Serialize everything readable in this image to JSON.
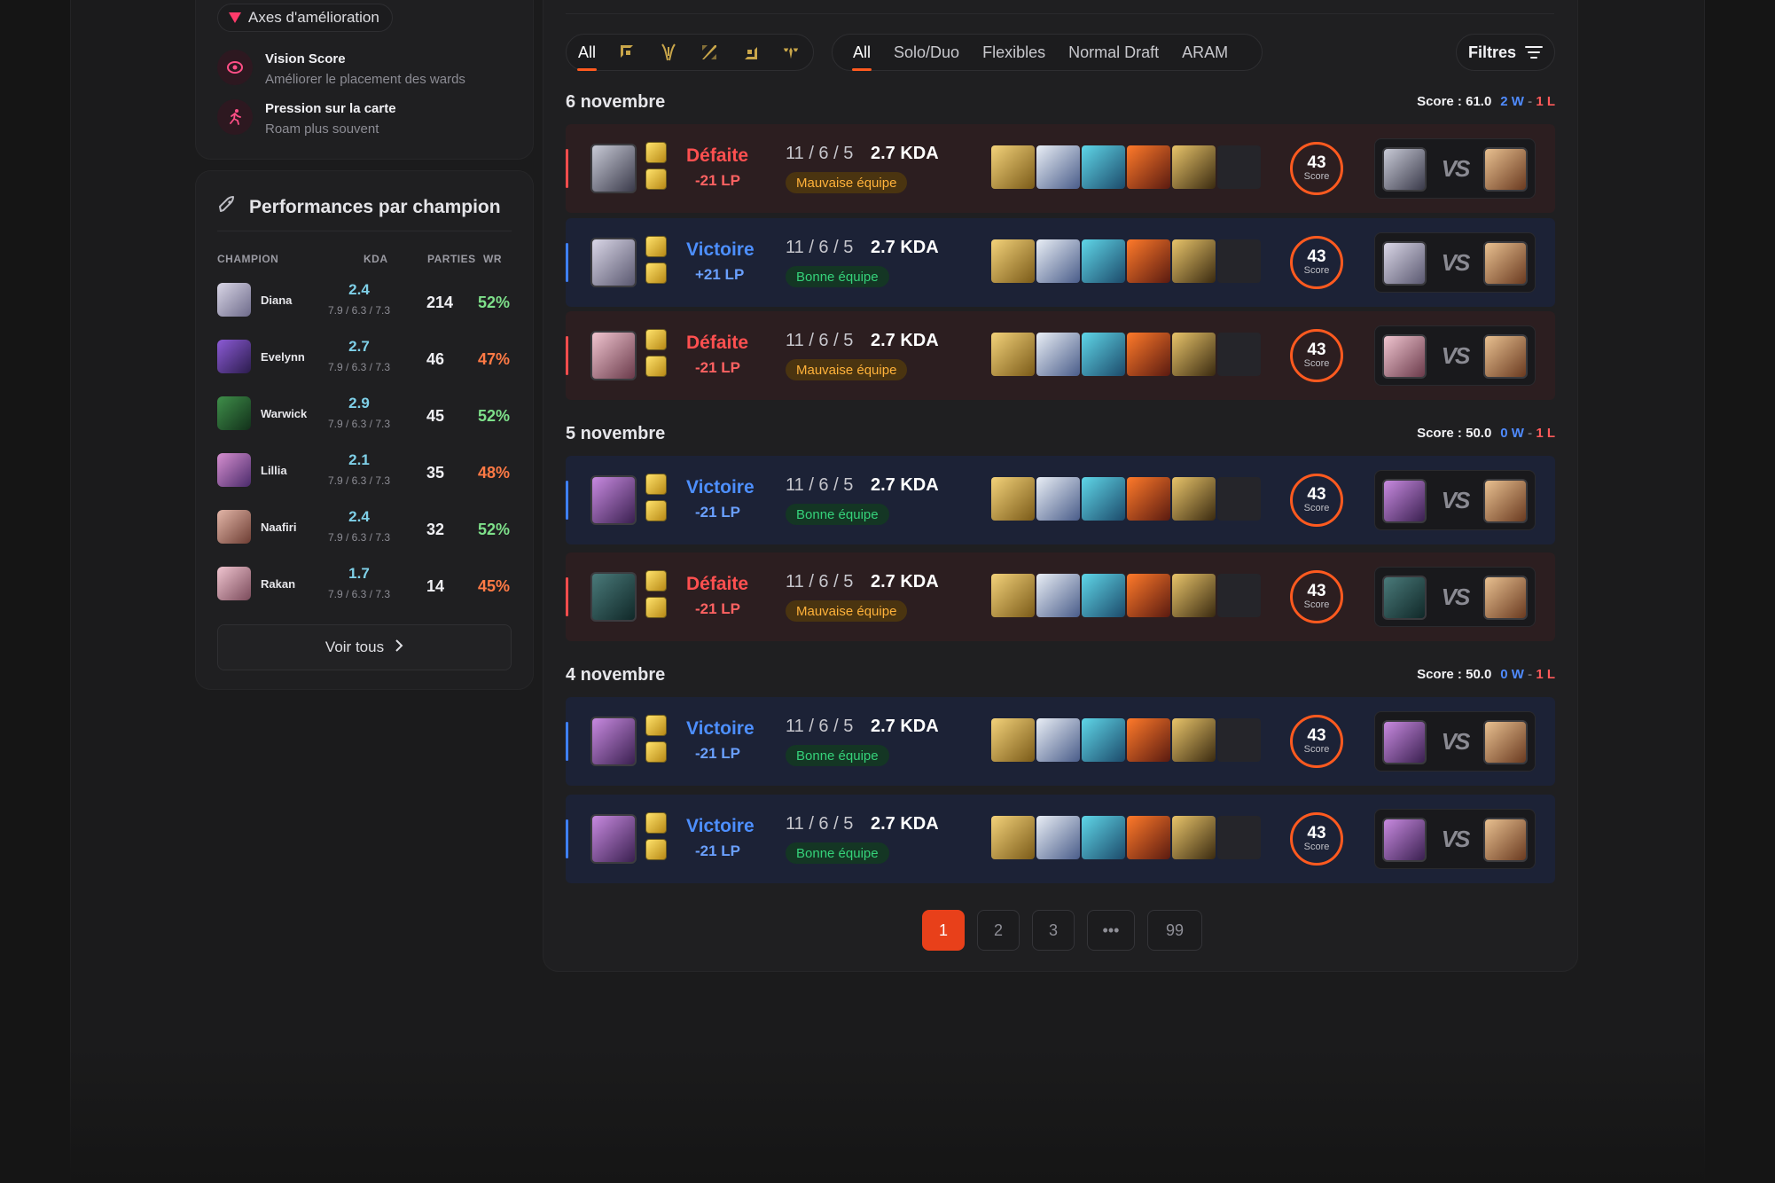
{
  "improvement": {
    "title": "Axes d'amélioration",
    "items": [
      {
        "title": "Vision Score",
        "subtitle": "Améliorer le placement des wards",
        "icon": "eye-icon"
      },
      {
        "title": "Pression sur la carte",
        "subtitle": "Roam plus souvent",
        "icon": "runner-icon"
      }
    ]
  },
  "performance": {
    "title": "Performances par champion",
    "columns": {
      "champion": "CHAMPION",
      "kda": "KDA",
      "games": "PARTIES",
      "wr": "WR"
    },
    "rows": [
      {
        "name": "Diana",
        "kda": "2.4",
        "kda_detail": "7.9 / 6.3 / 7.3",
        "games": "214",
        "wr": "52%",
        "wr_color": "#7ee08a"
      },
      {
        "name": "Evelynn",
        "kda": "2.7",
        "kda_detail": "7.9 / 6.3 / 7.3",
        "games": "46",
        "wr": "47%",
        "wr_color": "#ff7a45"
      },
      {
        "name": "Warwick",
        "kda": "2.9",
        "kda_detail": "7.9 / 6.3 / 7.3",
        "games": "45",
        "wr": "52%",
        "wr_color": "#7ee08a"
      },
      {
        "name": "Lillia",
        "kda": "2.1",
        "kda_detail": "7.9 / 6.3 / 7.3",
        "games": "35",
        "wr": "48%",
        "wr_color": "#ff7a45"
      },
      {
        "name": "Naafiri",
        "kda": "2.4",
        "kda_detail": "7.9 / 6.3 / 7.3",
        "games": "32",
        "wr": "52%",
        "wr_color": "#7ee08a"
      },
      {
        "name": "Rakan",
        "kda": "1.7",
        "kda_detail": "7.9 / 6.3 / 7.3",
        "games": "14",
        "wr": "45%",
        "wr_color": "#ff7a45"
      }
    ],
    "see_all": "Voir tous"
  },
  "role_tabs": {
    "all": "All",
    "roles": [
      "top-role-icon",
      "jungle-role-icon",
      "mid-role-icon",
      "bot-role-icon",
      "support-role-icon"
    ]
  },
  "queue_tabs": [
    "All",
    "Solo/Duo",
    "Flexibles",
    "Normal Draft",
    "ARAM"
  ],
  "filters_label": "Filtres",
  "days": [
    {
      "date": "6 novembre",
      "score": "Score : 61.0",
      "wins": "2 W",
      "losses": "1 L"
    },
    {
      "date": "5 novembre",
      "score": "Score : 50.0",
      "wins": "0 W",
      "losses": "1 L"
    },
    {
      "date": "4 novembre",
      "score": "Score : 50.0",
      "wins": "0 W",
      "losses": "1 L"
    }
  ],
  "matches": [
    {
      "result": "Défaite",
      "lp": "-21 LP",
      "kda_line": "11 / 6 / 5",
      "kda": "2.7 KDA",
      "team": "Mauvaise équipe",
      "score": "43",
      "score_label": "Score",
      "vs": "VS"
    },
    {
      "result": "Victoire",
      "lp": "+21 LP",
      "kda_line": "11 / 6 / 5",
      "kda": "2.7 KDA",
      "team": "Bonne équipe",
      "score": "43",
      "score_label": "Score",
      "vs": "VS"
    },
    {
      "result": "Défaite",
      "lp": "-21 LP",
      "kda_line": "11 / 6 / 5",
      "kda": "2.7 KDA",
      "team": "Mauvaise équipe",
      "score": "43",
      "score_label": "Score",
      "vs": "VS"
    },
    {
      "result": "Victoire",
      "lp": "-21 LP",
      "kda_line": "11 / 6 / 5",
      "kda": "2.7 KDA",
      "team": "Bonne équipe",
      "score": "43",
      "score_label": "Score",
      "vs": "VS"
    },
    {
      "result": "Défaite",
      "lp": "-21 LP",
      "kda_line": "11 / 6 / 5",
      "kda": "2.7 KDA",
      "team": "Mauvaise équipe",
      "score": "43",
      "score_label": "Score",
      "vs": "VS"
    },
    {
      "result": "Victoire",
      "lp": "-21 LP",
      "kda_line": "11 / 6 / 5",
      "kda": "2.7 KDA",
      "team": "Bonne équipe",
      "score": "43",
      "score_label": "Score",
      "vs": "VS"
    },
    {
      "result": "Victoire",
      "lp": "-21 LP",
      "kda_line": "11 / 6 / 5",
      "kda": "2.7 KDA",
      "team": "Bonne équipe",
      "score": "43",
      "score_label": "Score",
      "vs": "VS"
    }
  ],
  "pagination": [
    "1",
    "2",
    "3",
    "•••",
    "99"
  ],
  "colors": {
    "accent": "#ff5a1f",
    "win": "#4d8fff",
    "loss": "#ff5050"
  }
}
